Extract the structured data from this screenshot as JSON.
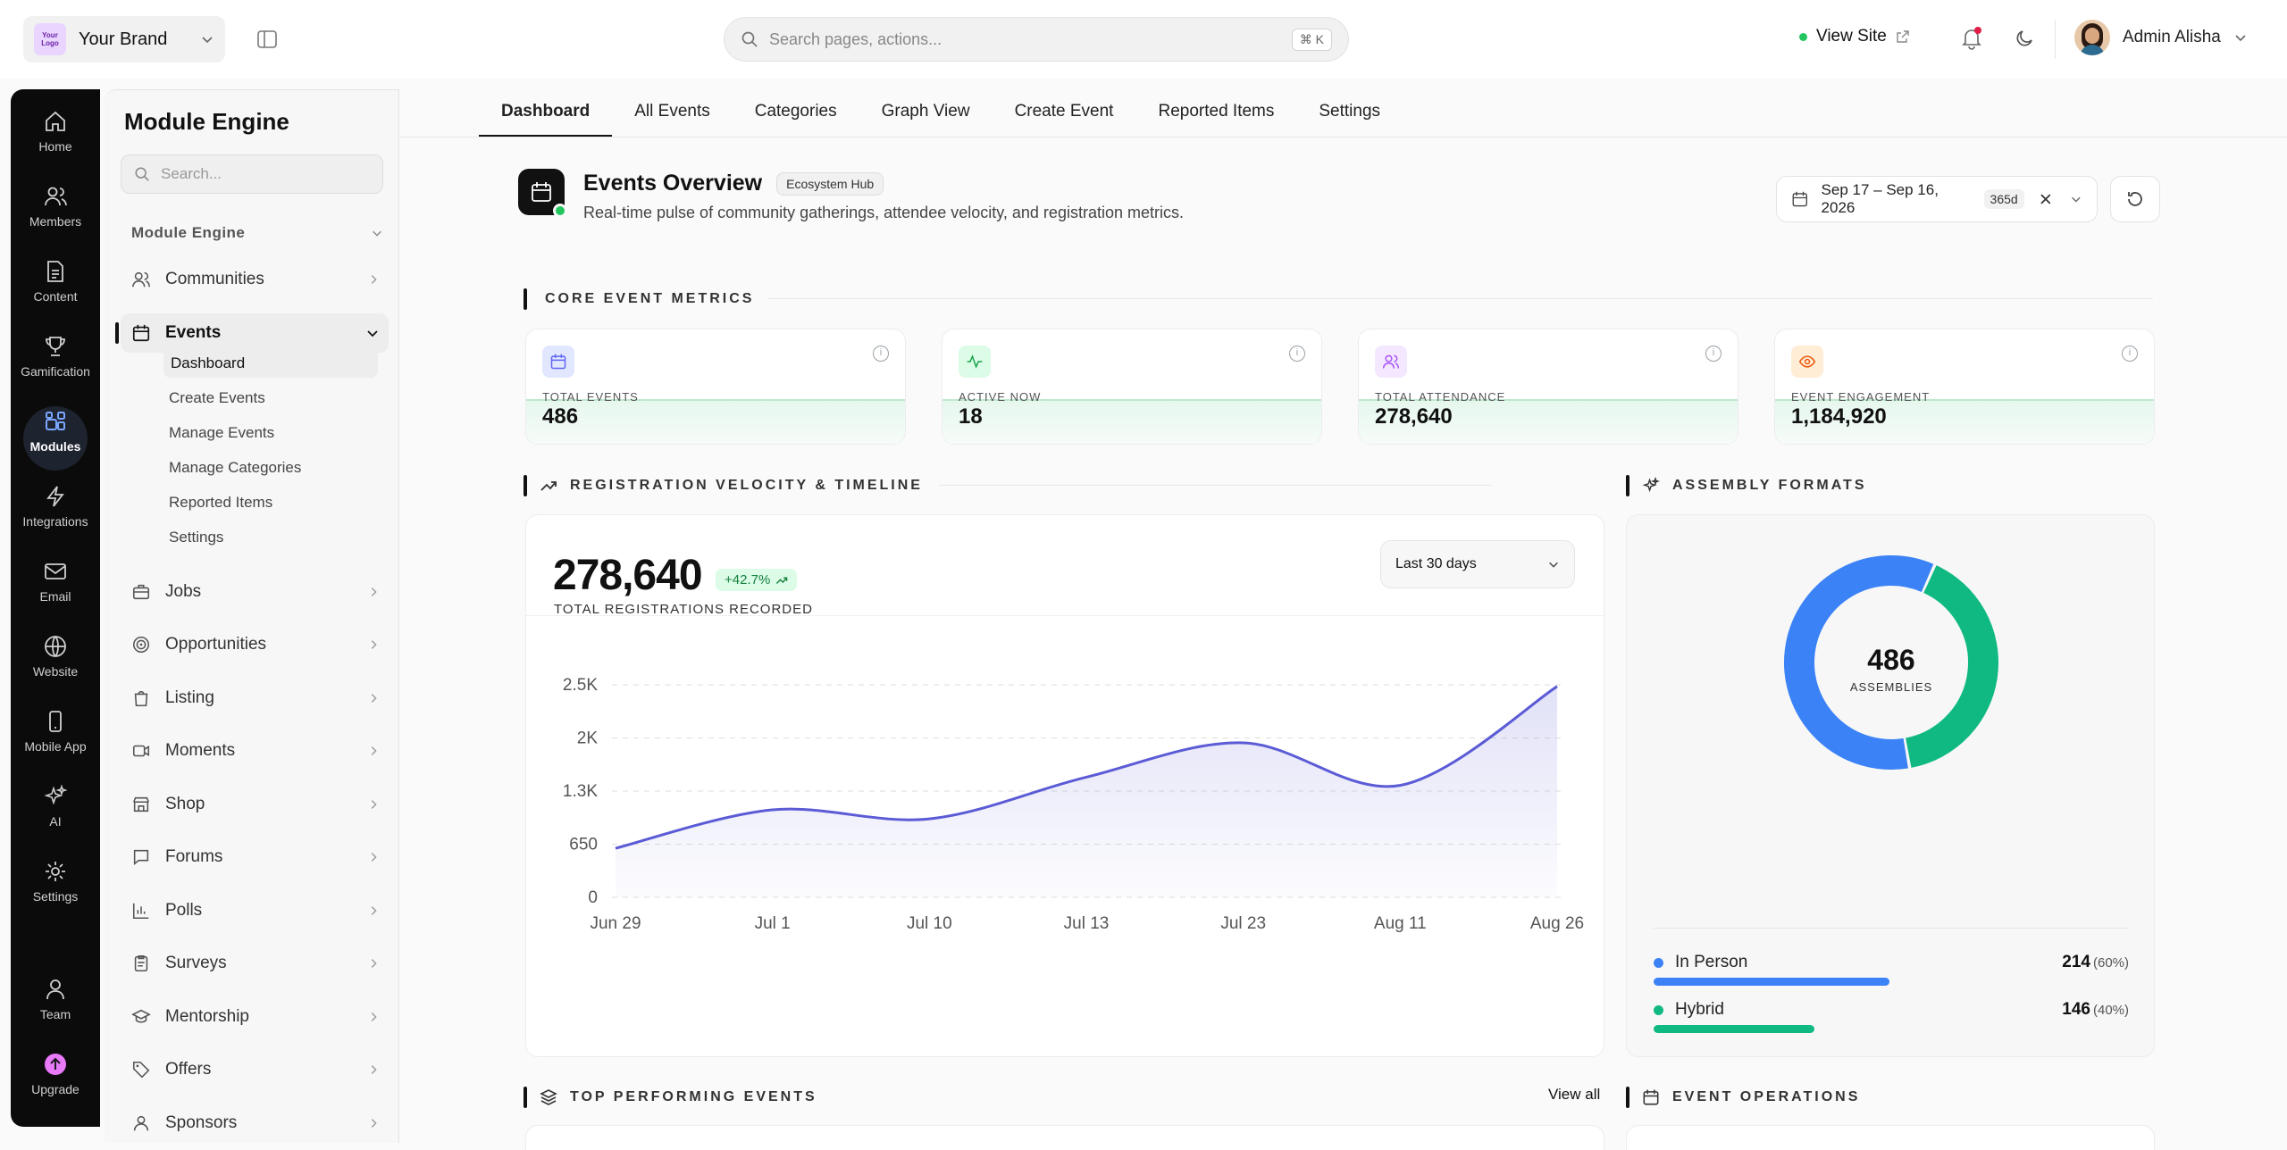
{
  "brand": {
    "logo_text": "Your Logo",
    "name": "Your Brand"
  },
  "search": {
    "placeholder": "Search pages, actions...",
    "shortcut": "⌘ K"
  },
  "header": {
    "view_site": "View Site",
    "user_name": "Admin Alisha"
  },
  "rail": [
    {
      "label": "Home",
      "icon": "home-icon"
    },
    {
      "label": "Members",
      "icon": "members-icon"
    },
    {
      "label": "Content",
      "icon": "content-icon"
    },
    {
      "label": "Gamification",
      "icon": "trophy-icon"
    },
    {
      "label": "Modules",
      "icon": "modules-icon",
      "active": true
    },
    {
      "label": "Integrations",
      "icon": "bolt-icon"
    },
    {
      "label": "Email",
      "icon": "mail-icon"
    },
    {
      "label": "Website",
      "icon": "globe-icon"
    },
    {
      "label": "Mobile App",
      "icon": "phone-icon"
    },
    {
      "label": "AI",
      "icon": "sparkles-icon"
    },
    {
      "label": "Settings",
      "icon": "gear-icon"
    },
    {
      "label": "Team",
      "icon": "team-icon"
    },
    {
      "label": "Upgrade",
      "icon": "upgrade-icon"
    }
  ],
  "panel": {
    "title": "Module Engine",
    "search_placeholder": "Search...",
    "group": "Module Engine",
    "items": [
      "Communities",
      "Events",
      "Jobs",
      "Opportunities",
      "Listing",
      "Moments",
      "Shop",
      "Forums",
      "Polls",
      "Surveys",
      "Mentorship",
      "Offers",
      "Sponsors"
    ],
    "events_sub": [
      "Dashboard",
      "Create Events",
      "Manage Events",
      "Manage Categories",
      "Reported Items",
      "Settings"
    ]
  },
  "tabs": [
    "Dashboard",
    "All Events",
    "Categories",
    "Graph View",
    "Create Event",
    "Reported Items",
    "Settings"
  ],
  "overview": {
    "title": "Events Overview",
    "badge": "Ecosystem Hub",
    "subtitle": "Real-time pulse of community gatherings, attendee velocity, and registration metrics.",
    "date_range": "Sep 17 – Sep 16, 2026",
    "range_badge": "365d"
  },
  "sections": {
    "core": "CORE EVENT METRICS",
    "velocity": "REGISTRATION VELOCITY & TIMELINE",
    "formats": "ASSEMBLY FORMATS",
    "top": "TOP PERFORMING EVENTS",
    "ops": "EVENT OPERATIONS",
    "view_all": "View all"
  },
  "metrics": [
    {
      "label": "TOTAL EVENTS",
      "value": "486",
      "color": "#6366f1",
      "bg": "#e0e7ff",
      "icon": "calendar-icon"
    },
    {
      "label": "ACTIVE NOW",
      "value": "18",
      "color": "#16a34a",
      "bg": "#dcfce7",
      "icon": "activity-icon"
    },
    {
      "label": "TOTAL ATTENDANCE",
      "value": "278,640",
      "color": "#a855f7",
      "bg": "#f3e8ff",
      "icon": "users-icon"
    },
    {
      "label": "EVENT ENGAGEMENT",
      "value": "1,184,920",
      "color": "#ea580c",
      "bg": "#ffedd5",
      "icon": "eye-icon"
    }
  ],
  "velocity": {
    "total": "278,640",
    "change": "+42.7%",
    "total_label": "TOTAL REGISTRATIONS RECORDED",
    "period": "Last 30 days"
  },
  "chart_data": [
    {
      "type": "area",
      "x": [
        "Jun 29",
        "Jul 1",
        "Jul 10",
        "Jul 13",
        "Jul 23",
        "Aug 11",
        "Aug 26"
      ],
      "y": [
        600,
        1070,
        960,
        1470,
        1890,
        1370,
        2580
      ],
      "y_ticks": [
        "0",
        "650",
        "1.3K",
        "2K",
        "2.5K"
      ],
      "y_tick_values": [
        0,
        650,
        1300,
        1950,
        2600
      ],
      "ylim": [
        0,
        2600
      ],
      "grid": true,
      "color": "#5b5bd6"
    },
    {
      "type": "pie",
      "center_value": "486",
      "center_label": "ASSEMBLIES",
      "series": [
        {
          "name": "In Person",
          "value": 214,
          "pct": "(60%)",
          "color": "#3b82f6"
        },
        {
          "name": "Hybrid",
          "value": 146,
          "pct": "(40%)",
          "color": "#10b981"
        }
      ]
    }
  ]
}
